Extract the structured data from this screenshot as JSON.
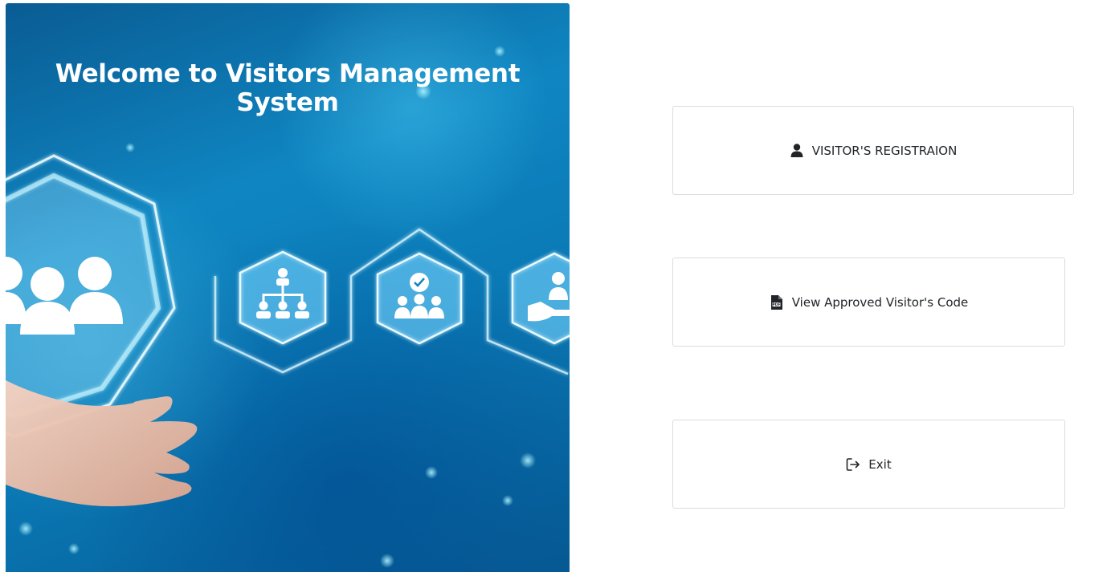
{
  "hero": {
    "title": "Welcome to Visitors Management System"
  },
  "actions": {
    "register": {
      "label": "VISITOR'S REGISTRAION",
      "icon": "user-icon"
    },
    "view_code": {
      "label": "View Approved Visitor's Code",
      "icon": "pdf-file-icon"
    },
    "exit": {
      "label": "Exit",
      "icon": "sign-out-icon"
    }
  }
}
